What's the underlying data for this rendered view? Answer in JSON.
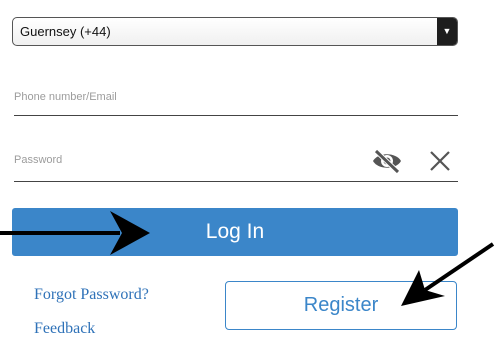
{
  "country_select": {
    "value": "Guernsey (+44)",
    "arrow_glyph": "▼"
  },
  "phone_field": {
    "placeholder": "Phone number/Email"
  },
  "password_field": {
    "placeholder": "Password",
    "visibility_icon": "eye-slash-icon",
    "clear_icon": "close-icon"
  },
  "login": {
    "label": "Log In"
  },
  "links": {
    "forgot_password": "Forgot Password?",
    "feedback": "Feedback"
  },
  "register": {
    "label": "Register"
  },
  "colors": {
    "accent": "#3b86c9",
    "link": "#2f72b8",
    "placeholder": "#9c9c9c",
    "annotation_arrow": "#000000"
  },
  "annotations": {
    "arrows": [
      "arrow-pointing-to-login-button",
      "arrow-pointing-to-register-button"
    ]
  }
}
